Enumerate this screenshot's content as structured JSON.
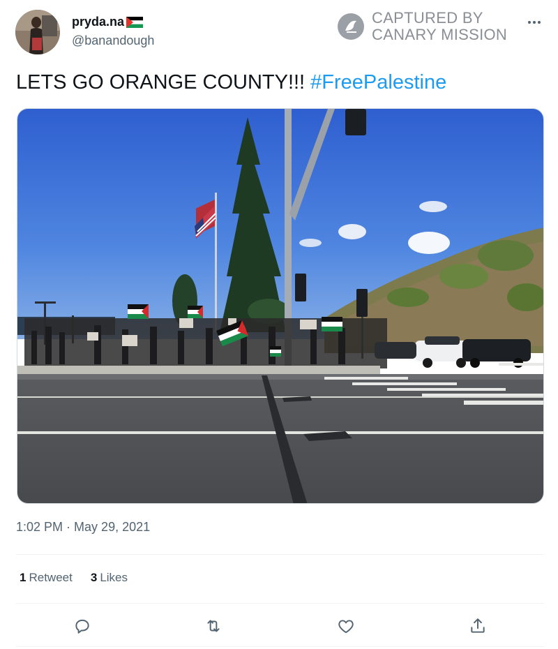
{
  "user": {
    "display_name": "pryda.na",
    "handle": "@banandough",
    "flag_icon": "palestine-flag-emoji"
  },
  "watermark": {
    "line1": "CAPTURED BY",
    "line2": "CANARY MISSION"
  },
  "tweet": {
    "text": "LETS GO ORANGE COUNTY!!! ",
    "hashtag": "#FreePalestine",
    "time": "1:02 PM",
    "separator": " · ",
    "date": "May 29, 2021"
  },
  "stats": {
    "retweets_count": "1",
    "retweets_label": "Retweet",
    "likes_count": "3",
    "likes_label": "Likes"
  },
  "actions": [
    "reply-icon",
    "retweet-icon",
    "like-icon",
    "share-icon"
  ],
  "colors": {
    "hashtag": "#1d9bf0",
    "secondary_text": "#536471",
    "primary_text": "#0f1419",
    "divider": "#eff3f4"
  }
}
